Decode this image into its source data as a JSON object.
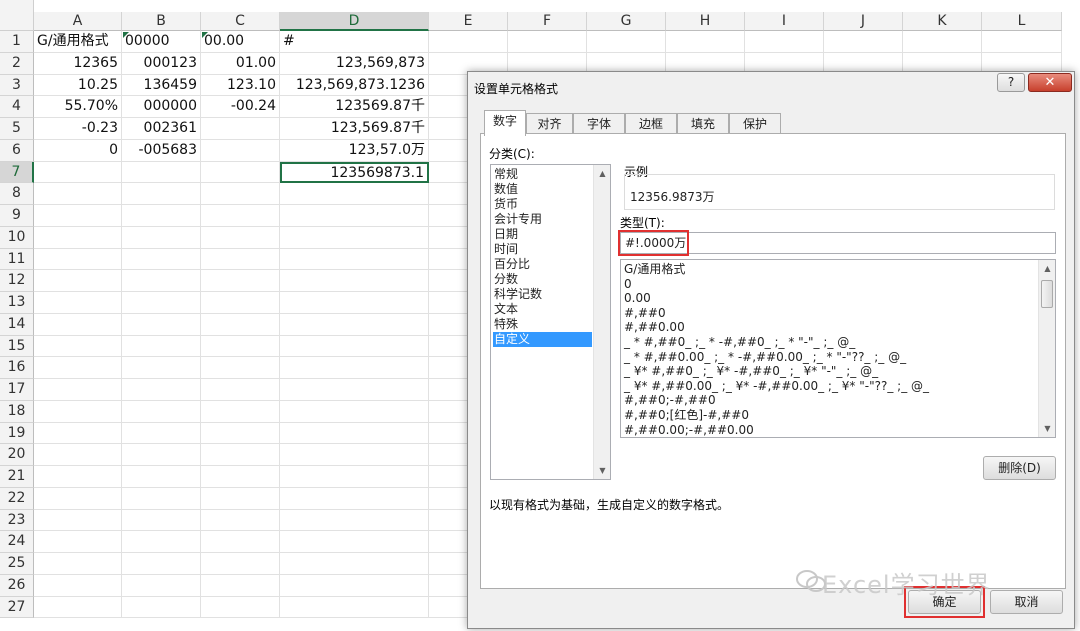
{
  "spreadsheet": {
    "columns": [
      "A",
      "B",
      "C",
      "D",
      "E",
      "F",
      "G",
      "H",
      "I",
      "J",
      "K",
      "L"
    ],
    "rows": [
      "1",
      "2",
      "3",
      "4",
      "5",
      "6",
      "7",
      "8",
      "9",
      "10",
      "11",
      "12",
      "13",
      "14",
      "15",
      "16",
      "17",
      "18",
      "19",
      "20",
      "21",
      "22",
      "23",
      "24",
      "25",
      "26",
      "27"
    ],
    "cells": {
      "A1": "G/通用格式",
      "B1": "00000",
      "C1": "00.00",
      "D1": "#",
      "A2": "12365",
      "B2": "000123",
      "C2": "01.00",
      "D2": "123,569,873",
      "A3": "10.25",
      "B3": "136459",
      "C3": "123.10",
      "D3": "123,569,873.1236",
      "A4": "55.70%",
      "B4": "000000",
      "C4": "-00.24",
      "D4": "123569.87千",
      "A5": "-0.23",
      "B5": "002361",
      "D5": "123,569.87千",
      "A6": "0",
      "B6": "-005683",
      "D6": "123,57.0万",
      "D7": "123569873.1"
    }
  },
  "dialog": {
    "title": "设置单元格格式",
    "help_label": "?",
    "close_label": "✕",
    "tabs": [
      "数字",
      "对齐",
      "字体",
      "边框",
      "填充",
      "保护"
    ],
    "category_label": "分类(C):",
    "categories": [
      "常规",
      "数值",
      "货币",
      "会计专用",
      "日期",
      "时间",
      "百分比",
      "分数",
      "科学记数",
      "文本",
      "特殊",
      "自定义"
    ],
    "selected_category": "自定义",
    "sample_label": "示例",
    "sample_value": "12356.9873万",
    "type_label": "类型(T):",
    "type_value": "#!.0000万",
    "formats": [
      "G/通用格式",
      "0",
      "0.00",
      "#,##0",
      "#,##0.00",
      "_ * #,##0_ ;_ * -#,##0_ ;_ * \"-\"_ ;_ @_",
      "_ * #,##0.00_ ;_ * -#,##0.00_ ;_ * \"-\"??_ ;_ @_",
      "_ ¥* #,##0_ ;_ ¥* -#,##0_ ;_ ¥* \"-\"_ ;_ @_",
      "_ ¥* #,##0.00_ ;_ ¥* -#,##0.00_ ;_ ¥* \"-\"??_ ;_ @_",
      "#,##0;-#,##0",
      "#,##0;[红色]-#,##0",
      "#,##0.00;-#,##0.00"
    ],
    "delete_label": "删除(D)",
    "description": "以现有格式为基础，生成自定义的数字格式。",
    "ok_label": "确定",
    "cancel_label": "取消"
  },
  "watermark": "Excel学习世界",
  "colors": {
    "excel_green": "#217346",
    "selection_blue": "#3399ff",
    "highlight_red": "#e03030"
  }
}
